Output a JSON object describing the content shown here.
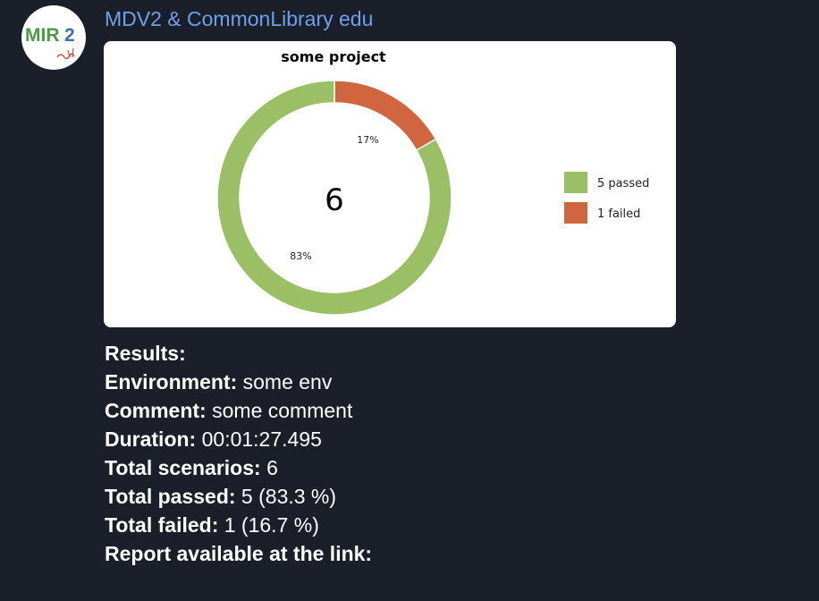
{
  "message": {
    "sender_name": "MDV2 & CommonLibrary edu",
    "avatar": {
      "text": "MIR",
      "text_color": "#4a9a48",
      "accent_color": "#d04a3a"
    }
  },
  "chart_data": {
    "type": "pie",
    "title": "some project",
    "center_label": "6",
    "categories": [
      "passed",
      "failed"
    ],
    "values": [
      5,
      1
    ],
    "slice_labels": [
      "83%",
      "17%"
    ],
    "legend": [
      "5 passed",
      "1 failed"
    ],
    "legend_position": "right",
    "colors": [
      "#9bbf64",
      "#d0663f"
    ],
    "donut": true
  },
  "results": {
    "heading": "Results:",
    "rows": [
      {
        "label": "Environment:",
        "value": " some env"
      },
      {
        "label": "Comment:",
        "value": " some comment"
      },
      {
        "label": "Duration:",
        "value": " 00:01:27.495"
      },
      {
        "label": "Total scenarios:",
        "value": " 6"
      },
      {
        "label": "Total passed:",
        "value": " 5 (83.3 %)"
      },
      {
        "label": "Total failed:",
        "value": " 1 (16.7 %)"
      }
    ],
    "footer": "Report available at the link:"
  },
  "colors": {
    "background": "#1b1f29",
    "sender_name": "#6fa0ec",
    "text": "#ffffff"
  }
}
